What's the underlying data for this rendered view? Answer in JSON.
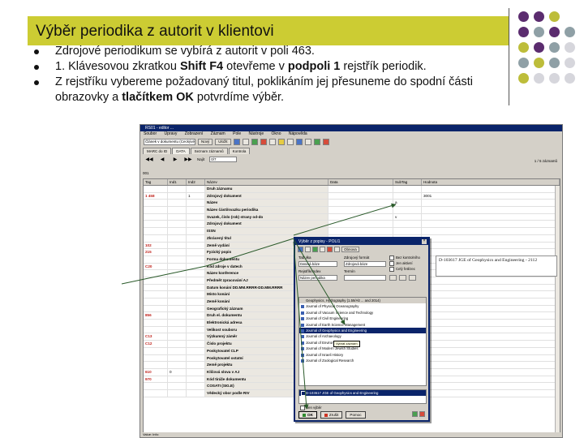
{
  "slide": {
    "title": "Výběr periodika z autorit v klientovi",
    "bullets": {
      "b1": "Zdrojové periodikum se vybírá z autorit v poli 463.",
      "b2_pre": "1. Klávesovou zkratkou ",
      "b2_key": "Shift F4",
      "b2_mid": " otevřeme v ",
      "b2_field": "podpoli 1",
      "b2_post": " rejstřík periodik.",
      "b3_pre": "Z rejstříku vybereme požadovaný titul, poklikáním jej přesuneme do spodní části obrazovky a ",
      "b3_btn": "tlačítkem OK",
      "b3_post": " potvrdíme výběr."
    },
    "colors": {
      "accent": "#cccc33",
      "dot_purple": "#5b2c6f",
      "dot_gray": "#8fa0a6",
      "dot_olive": "#bdbd3a",
      "dot_light": "#d6d6dc"
    }
  },
  "app": {
    "title": "RS01 - editor ...",
    "menu": [
      "Soubor",
      "Úpravy",
      "Zobrazení",
      "Záznam",
      "Pole",
      "Nástroje",
      "Okno",
      "Nápověda"
    ],
    "toolbar": {
      "template": "Článek v dokumentu (Ceckývé)",
      "new_label": "Nový",
      "save_label": "Uložit"
    },
    "tabs": [
      "MARC do ID",
      "DATA",
      "Seznam záznamů",
      "Kontrola"
    ],
    "nav": {
      "go_label": "Najít",
      "go_value": "0/7",
      "right_text": "1 / 5 záznamů"
    },
    "record_id": "001",
    "grid": {
      "headers": [
        "Tag",
        "Ind1",
        "Ind2",
        "Název",
        "Data",
        "SubTag",
        "Hodnota"
      ],
      "rows": [
        {
          "tag": "",
          "ind1": "",
          "ind2": "",
          "name": "Druh záznamu",
          "data": "",
          "sub": "",
          "val": ""
        },
        {
          "tag": "1 458",
          "ind1": "",
          "ind2": "1",
          "name": "Zdrojový dokument",
          "data": "",
          "sub": "",
          "val": "3001"
        },
        {
          "tag": "",
          "ind1": "",
          "ind2": "",
          "name": "Název",
          "data": "",
          "sub": "a",
          "val": ""
        },
        {
          "tag": "",
          "ind1": "",
          "ind2": "",
          "name": "Název části/svazku periodika",
          "data": "",
          "sub": "",
          "val": ""
        },
        {
          "tag": "",
          "ind1": "",
          "ind2": "",
          "name": "Svazek, číslo (rok) strany od-do",
          "data": "",
          "sub": "v",
          "val": ""
        },
        {
          "tag": "",
          "ind1": "",
          "ind2": "",
          "name": "Zdrojový dokument",
          "data": "",
          "sub": "",
          "val": ""
        },
        {
          "tag": "",
          "ind1": "",
          "ind2": "",
          "name": "ISSN",
          "data": "",
          "sub": "",
          "val": ""
        },
        {
          "tag": "",
          "ind1": "",
          "ind2": "",
          "name": "Zkrácený titul",
          "data": "",
          "sub": "",
          "val": ""
        },
        {
          "tag": "102",
          "ind1": "",
          "ind2": "",
          "name": "Země vydání",
          "data": "",
          "sub": "",
          "val": ""
        },
        {
          "tag": "215",
          "ind1": "",
          "ind2": "",
          "name": "Fyzický popis",
          "data": "",
          "sub": "",
          "val": ""
        },
        {
          "tag": "",
          "ind1": "",
          "ind2": "",
          "name": "Forma dokumentu",
          "data": "",
          "sub": "",
          "val": ""
        },
        {
          "tag": "C20",
          "ind1": "",
          "ind2": "",
          "name": "Kód zdroje v datech",
          "data": "",
          "sub": "",
          "val": ""
        },
        {
          "tag": "",
          "ind1": "",
          "ind2": "",
          "name": "Název konference",
          "data": "",
          "sub": "",
          "val": ""
        },
        {
          "tag": "",
          "ind1": "",
          "ind2": "",
          "name": "Předmět zpracování AJ",
          "data": "",
          "sub": "",
          "val": ""
        },
        {
          "tag": "",
          "ind1": "",
          "ind2": "",
          "name": "Datum konání DD.MM.RRRR-DD.MM.RRRR",
          "data": "",
          "sub": "",
          "val": ""
        },
        {
          "tag": "",
          "ind1": "",
          "ind2": "",
          "name": "Místo konání",
          "data": "",
          "sub": "",
          "val": ""
        },
        {
          "tag": "",
          "ind1": "",
          "ind2": "",
          "name": "Země konání",
          "data": "",
          "sub": "",
          "val": ""
        },
        {
          "tag": "",
          "ind1": "",
          "ind2": "",
          "name": "Geografický záznam",
          "data": "",
          "sub": "",
          "val": ""
        },
        {
          "tag": "856",
          "ind1": "",
          "ind2": "",
          "name": "Druh el. dokumentu",
          "data": "",
          "sub": "",
          "val": ""
        },
        {
          "tag": "",
          "ind1": "",
          "ind2": "",
          "name": "Elektronická adresa",
          "data": "",
          "sub": "",
          "val": ""
        },
        {
          "tag": "",
          "ind1": "",
          "ind2": "",
          "name": "Velikost souboru",
          "data": "",
          "sub": "",
          "val": ""
        },
        {
          "tag": "C13",
          "ind1": "",
          "ind2": "",
          "name": "Výzkumný záměr",
          "data": "",
          "sub": "",
          "val": ""
        },
        {
          "tag": "C12",
          "ind1": "",
          "ind2": "",
          "name": "Číslo projektu",
          "data": "",
          "sub": "",
          "val": ""
        },
        {
          "tag": "",
          "ind1": "",
          "ind2": "",
          "name": "Poskytovatel CLP",
          "data": "",
          "sub": "",
          "val": ""
        },
        {
          "tag": "",
          "ind1": "",
          "ind2": "",
          "name": "Poskytovatel ostatní",
          "data": "",
          "sub": "",
          "val": ""
        },
        {
          "tag": "",
          "ind1": "",
          "ind2": "",
          "name": "Země projektu",
          "data": "",
          "sub": "",
          "val": ""
        },
        {
          "tag": "610",
          "ind1": "0",
          "ind2": "",
          "name": "Klíčová slova v AJ",
          "data": "",
          "sub": "",
          "val": ""
        },
        {
          "tag": "970",
          "ind1": "",
          "ind2": "",
          "name": "Kód tiráže dokumentu",
          "data": "",
          "sub": "",
          "val": ""
        },
        {
          "tag": "",
          "ind1": "",
          "ind2": "",
          "name": "COSATI (SIG.E)",
          "data": "",
          "sub": "",
          "val": ""
        },
        {
          "tag": "",
          "ind1": "",
          "ind2": "",
          "name": "Vědecký obor podle RIV",
          "data": "",
          "sub": "",
          "val": ""
        }
      ]
    },
    "status": "Value: Info:"
  },
  "dialog": {
    "title": "Výběr z popisy - POLI1",
    "toolbar": {
      "btn": "Obnova"
    },
    "form": {
      "label_left": "Tabulka",
      "label_mid": "Zdrojový formát",
      "label_left2": "Rejstřík/Index",
      "label_mid2": "Termín",
      "sel_left": "Datová báze",
      "sel_mid": "Zdrojová báze",
      "sel_left2": "Název periodika",
      "checks": [
        "Bez kontrolního",
        "Jen aktivní",
        "Celý řetězec"
      ]
    },
    "list": {
      "header": "Geophysics, Hydrography (1.59/Alt ... and 2014)",
      "items": [
        "Journal of Physical Oceanography",
        "Journal of Vacuum Science and Technology",
        "Journal of Civil Engineering",
        "Journal of Earth Science Management",
        "Journal of Geophysics and Engineering",
        "Journal of Archaeology",
        "Journal of Environmental Science",
        "Journal of Modern Jewish Studies",
        "Journal of Israeli History",
        "Journal of Zoological Research"
      ],
      "selected_index": 4,
      "tooltip": "Vybrat záznam"
    },
    "selected": "D-103617 JGE of Geophysics and Engineering",
    "check_bottom": "Jen výběr",
    "btn_ok": "OK",
    "btn_cancel": "Zrušit",
    "btn_help": "Pomoc"
  },
  "preview": {
    "text": "D-103617 JGE of Geophysics and Engineering - 2112"
  }
}
